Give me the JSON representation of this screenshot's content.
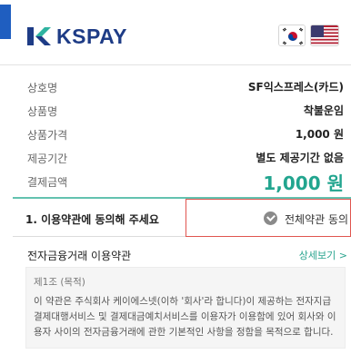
{
  "brand": {
    "logo_text": "KSPAY"
  },
  "language": {
    "korean_flag": "korean-flag-icon",
    "us_flag": "us-flag-icon"
  },
  "colors": {
    "brand_blue": "#1e3c86",
    "accent_teal": "#22a58f",
    "agree_border": "#e0554f",
    "left_accent": "#1f5ec0"
  },
  "payment_info": {
    "merchant_label": "상호명",
    "merchant_value": "SF익스프레스(카드)",
    "product_label": "상품명",
    "product_value": "착불운임",
    "price_label": "상품가격",
    "price_value": "1,000 원",
    "period_label": "제공기간",
    "period_value": "별도 제공기간 없음",
    "amount_label": "결제금액",
    "amount_value": "1,000 원"
  },
  "agreement": {
    "title": "1. 이용약관에 동의해 주세요",
    "agree_all_label": "전체약관 동의"
  },
  "terms": {
    "title": "전자금융거래 이용약관",
    "more_label": "상세보기 >",
    "article": "제1조 (목적)",
    "text": "이 약관은 주식회사 케이에스넷(이하 '회사'라 합니다)이 제공하는 전자지급결제대행서비스 및 결제대금예치서비스를 이용자가 이용함에 있어 회사와 이용자 사이의 전자금융거래에 관한 기본적인 사항을 정함을 목적으로 합니다."
  }
}
